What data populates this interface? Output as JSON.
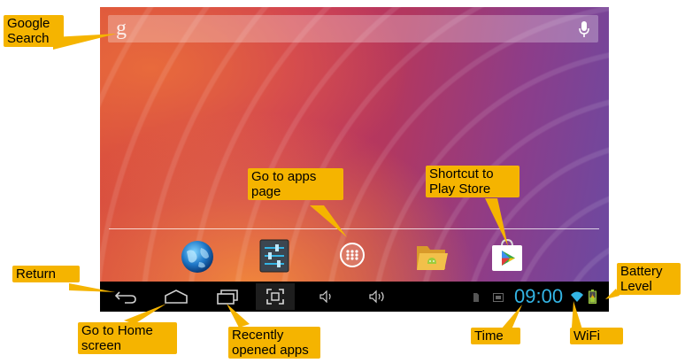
{
  "callouts": {
    "google_search": "Google\nSearch",
    "apps_page": "Go to apps\npage",
    "play_store": "Shortcut to\nPlay Store",
    "return": "Return",
    "home": "Go to Home\nscreen",
    "recent": "Recently\nopened apps",
    "time": "Time",
    "wifi": "WiFi",
    "battery": "Battery\nLevel"
  },
  "search": {
    "logo_letter": "g"
  },
  "status": {
    "time": "09:00"
  },
  "icons": {
    "dock": [
      "browser-globe-icon",
      "settings-icon",
      "all-apps-icon",
      "file-manager-icon",
      "play-store-icon"
    ],
    "nav": [
      "back-icon",
      "home-icon",
      "recent-apps-icon",
      "screenshot-icon",
      "volume-down-icon",
      "volume-up-icon"
    ],
    "status": [
      "sd-card-icon",
      "screenshot-notification-icon",
      "wifi-icon",
      "battery-icon"
    ]
  },
  "colors": {
    "callout": "#f5b400",
    "clock": "#33b5e5",
    "nav_bar": "#000000"
  }
}
